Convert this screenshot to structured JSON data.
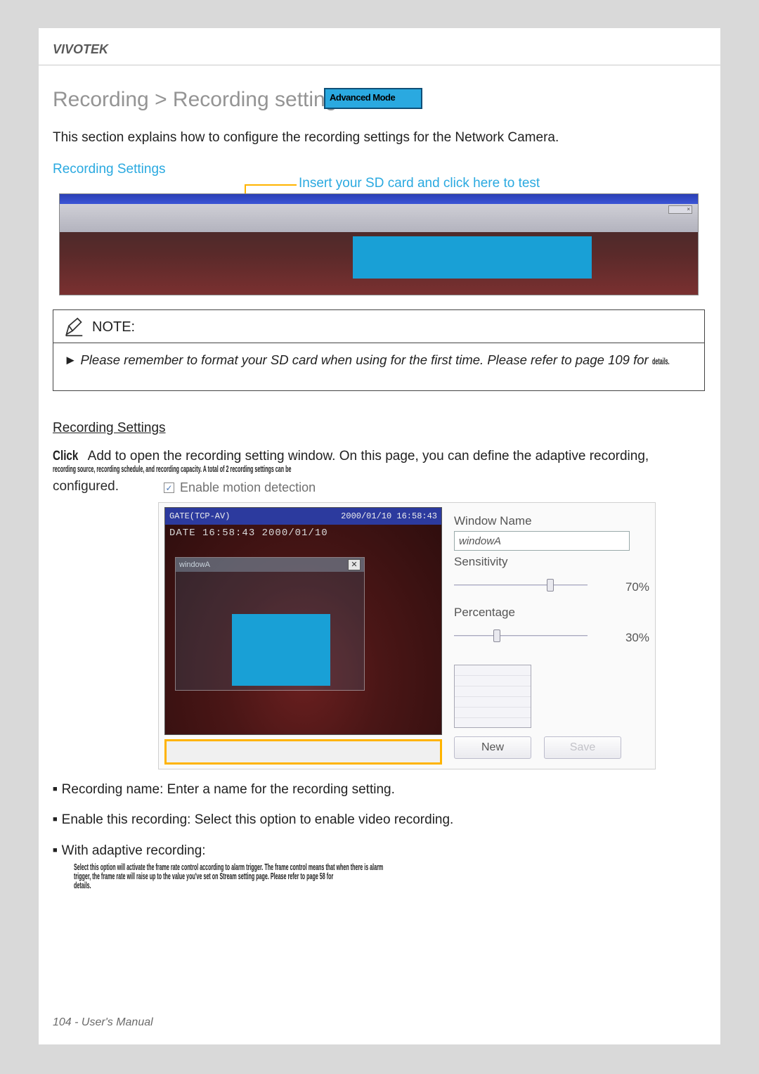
{
  "brand": "VIVOTEK",
  "breadcrumb": "Recording > Recording settings",
  "badge_label": "Advanced Mode",
  "intro_text": "This section explains how to configure the recording settings for the Network Camera.",
  "subhead_blue": "Recording Settings",
  "callout_text": "Insert your SD card and click here to test",
  "note": {
    "title": "NOTE:",
    "body_prefix": "► ",
    "body": "Please remember to format your SD card when using for the first time. Please refer to page 109 for",
    "body_tail": "details."
  },
  "rec_settings_header": "Recording Settings",
  "click_add": {
    "lead_word": "Click",
    "word2": "Add",
    "rest": "to open the recording setting window. On this page, you can define the adaptive recording,",
    "tail_compressed": "recording source, recording schedule, and recording capacity. A total of 2 recording settings can be"
  },
  "configured_word": "configured.",
  "motion": {
    "enable_label": "Enable motion detection",
    "titlebar_left": "GATE(TCP-AV)",
    "titlebar_right": "2000/01/10 16:58:43",
    "osd": "DATE 16:58:43 2000/01/10",
    "win_label": "windowA",
    "side": {
      "name_label": "Window Name",
      "name_value": "windowA",
      "sens_label": "Sensitivity",
      "sens_value": "70%",
      "perc_label": "Percentage",
      "perc_value": "30%"
    },
    "buttons": {
      "new": "New",
      "save": "Save"
    }
  },
  "bullets": {
    "b1": "Recording name: Enter a name for the recording setting.",
    "b2": "Enable this recording: Select this option to enable video recording.",
    "b3": "With adaptive recording:",
    "b3_sub1": "Select this option will activate the frame rate control according to alarm trigger. The frame control means that when there is alarm",
    "b3_sub2": "trigger, the frame rate will raise up to the value you've set on Stream setting page. Please refer to page 58 for",
    "b3_sub3": "details."
  },
  "footer": "104 - User's Manual"
}
